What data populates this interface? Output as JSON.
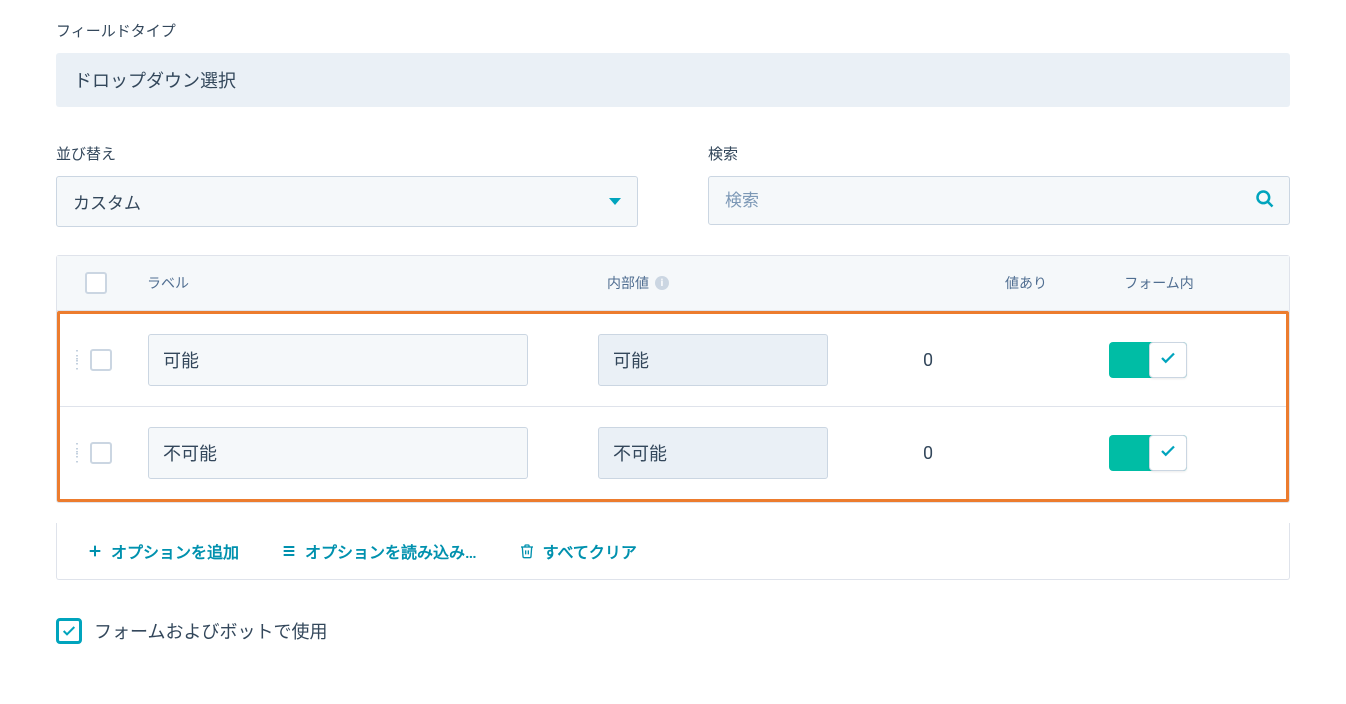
{
  "fieldType": {
    "label": "フィールドタイプ",
    "value": "ドロップダウン選択"
  },
  "sort": {
    "label": "並び替え",
    "selected": "カスタム"
  },
  "search": {
    "label": "検索",
    "placeholder": "検索"
  },
  "table": {
    "headers": {
      "label": "ラベル",
      "internal": "内部値",
      "count": "値あり",
      "inForm": "フォーム内"
    },
    "rows": [
      {
        "label": "可能",
        "internal": "可能",
        "count": "0",
        "inForm": true
      },
      {
        "label": "不可能",
        "internal": "不可能",
        "count": "0",
        "inForm": true
      }
    ]
  },
  "actions": {
    "add": "オプションを追加",
    "load": "オプションを読み込み…",
    "clear": "すべてクリア"
  },
  "useInForms": {
    "label": "フォームおよびボットで使用",
    "checked": true
  }
}
